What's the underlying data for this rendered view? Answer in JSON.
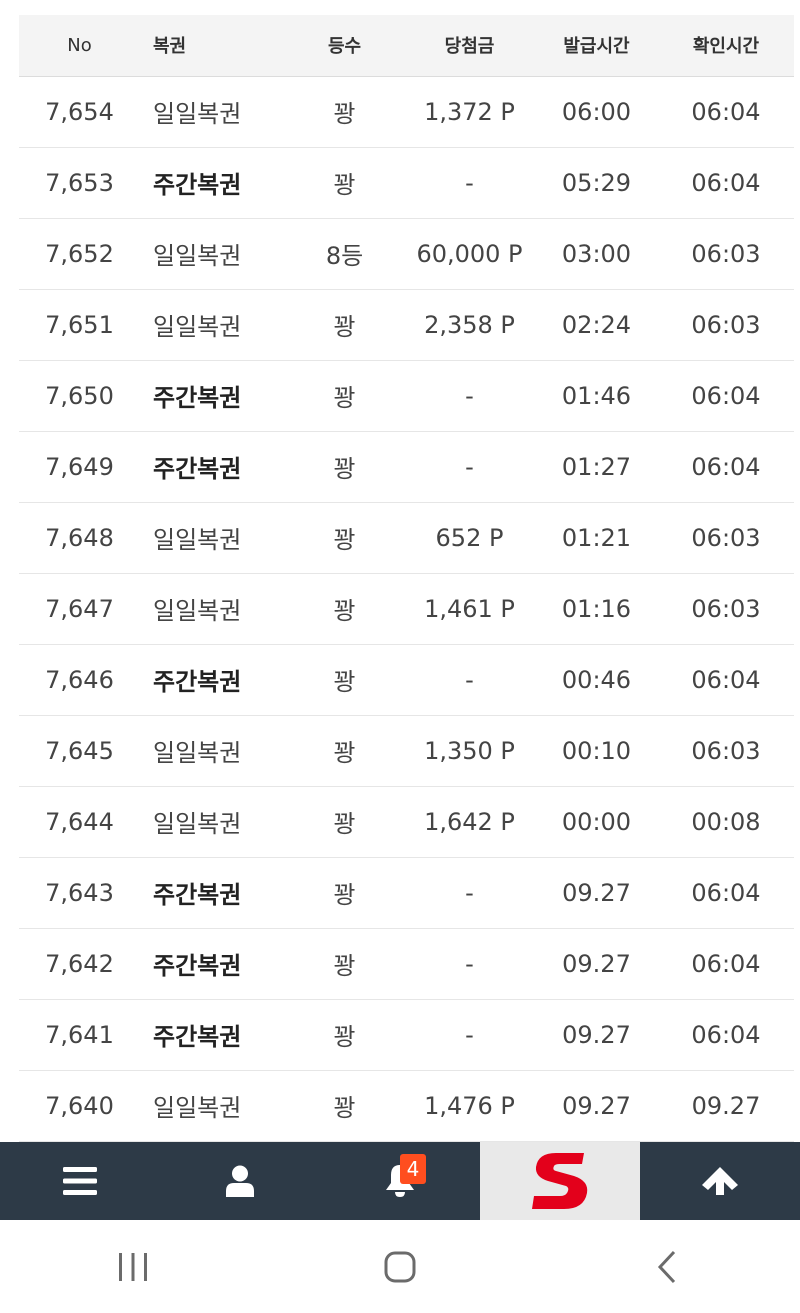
{
  "table": {
    "headers": {
      "no": "No",
      "type": "복권",
      "grade": "등수",
      "prize": "당첨금",
      "issue_time": "발급시간",
      "check_time": "확인시간"
    },
    "rows": [
      {
        "no": "7,654",
        "type": "일일복권",
        "weekly": false,
        "grade": "꽝",
        "prize": "1,372 P",
        "issue": "06:00",
        "check": "06:04"
      },
      {
        "no": "7,653",
        "type": "주간복권",
        "weekly": true,
        "grade": "꽝",
        "prize": "-",
        "issue": "05:29",
        "check": "06:04"
      },
      {
        "no": "7,652",
        "type": "일일복권",
        "weekly": false,
        "grade": "8등",
        "prize": "60,000 P",
        "issue": "03:00",
        "check": "06:03"
      },
      {
        "no": "7,651",
        "type": "일일복권",
        "weekly": false,
        "grade": "꽝",
        "prize": "2,358 P",
        "issue": "02:24",
        "check": "06:03"
      },
      {
        "no": "7,650",
        "type": "주간복권",
        "weekly": true,
        "grade": "꽝",
        "prize": "-",
        "issue": "01:46",
        "check": "06:04"
      },
      {
        "no": "7,649",
        "type": "주간복권",
        "weekly": true,
        "grade": "꽝",
        "prize": "-",
        "issue": "01:27",
        "check": "06:04"
      },
      {
        "no": "7,648",
        "type": "일일복권",
        "weekly": false,
        "grade": "꽝",
        "prize": "652 P",
        "issue": "01:21",
        "check": "06:03"
      },
      {
        "no": "7,647",
        "type": "일일복권",
        "weekly": false,
        "grade": "꽝",
        "prize": "1,461 P",
        "issue": "01:16",
        "check": "06:03"
      },
      {
        "no": "7,646",
        "type": "주간복권",
        "weekly": true,
        "grade": "꽝",
        "prize": "-",
        "issue": "00:46",
        "check": "06:04"
      },
      {
        "no": "7,645",
        "type": "일일복권",
        "weekly": false,
        "grade": "꽝",
        "prize": "1,350 P",
        "issue": "00:10",
        "check": "06:03"
      },
      {
        "no": "7,644",
        "type": "일일복권",
        "weekly": false,
        "grade": "꽝",
        "prize": "1,642 P",
        "issue": "00:00",
        "check": "00:08"
      },
      {
        "no": "7,643",
        "type": "주간복권",
        "weekly": true,
        "grade": "꽝",
        "prize": "-",
        "issue": "09.27",
        "check": "06:04"
      },
      {
        "no": "7,642",
        "type": "주간복권",
        "weekly": true,
        "grade": "꽝",
        "prize": "-",
        "issue": "09.27",
        "check": "06:04"
      },
      {
        "no": "7,641",
        "type": "주간복권",
        "weekly": true,
        "grade": "꽝",
        "prize": "-",
        "issue": "09.27",
        "check": "06:04"
      },
      {
        "no": "7,640",
        "type": "일일복권",
        "weekly": false,
        "grade": "꽝",
        "prize": "1,476 P",
        "issue": "09.27",
        "check": "09.27"
      }
    ]
  },
  "bottom_nav": {
    "items": [
      {
        "name": "menu-button",
        "icon": "hamburger-icon"
      },
      {
        "name": "profile-button",
        "icon": "user-icon"
      },
      {
        "name": "notifications-button",
        "icon": "bell-icon"
      },
      {
        "name": "logo-button",
        "icon": "s-logo-icon"
      },
      {
        "name": "scroll-top-button",
        "icon": "arrow-up-icon"
      }
    ],
    "notification_count": "4"
  },
  "system_nav": {
    "items": [
      {
        "name": "recent-apps-button",
        "icon": "recent-apps-icon"
      },
      {
        "name": "home-button",
        "icon": "home-icon"
      },
      {
        "name": "back-button",
        "icon": "back-icon"
      }
    ]
  },
  "colors": {
    "nav_background": "#2d3a47",
    "badge": "#ff4e1f",
    "logo_red": "#e3001b",
    "header_background": "#f4f4f4"
  }
}
